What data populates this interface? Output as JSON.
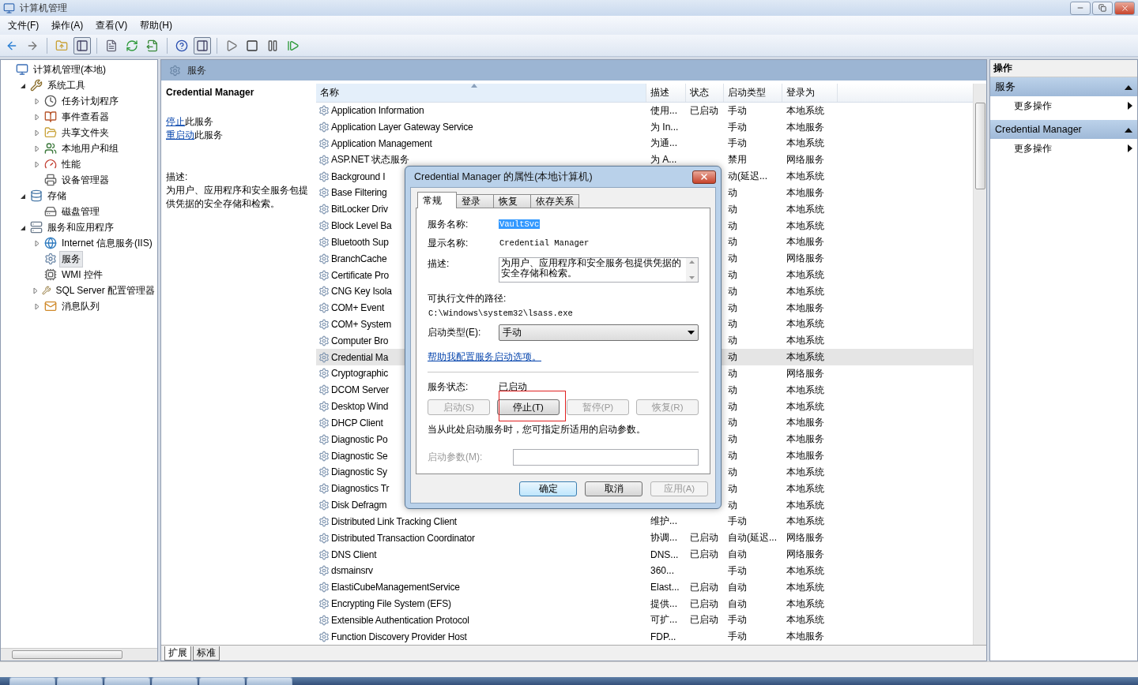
{
  "window": {
    "title": "计算机管理"
  },
  "menu": [
    "文件(F)",
    "操作(A)",
    "查看(V)",
    "帮助(H)"
  ],
  "tree": [
    {
      "label": "计算机管理(本地)",
      "kind": "computer",
      "selected": false,
      "children": [
        {
          "label": "系统工具",
          "kind": "tools",
          "expanded": true,
          "selected": false,
          "children": [
            {
              "label": "任务计划程序",
              "kind": "clock",
              "expanded": false,
              "selected": false
            },
            {
              "label": "事件查看器",
              "kind": "book",
              "expanded": false,
              "selected": false
            },
            {
              "label": "共享文件夹",
              "kind": "folder",
              "expanded": false,
              "selected": false
            },
            {
              "label": "本地用户和组",
              "kind": "users",
              "expanded": false,
              "selected": false
            },
            {
              "label": "性能",
              "kind": "gauge",
              "expanded": false,
              "selected": false
            },
            {
              "label": "设备管理器",
              "kind": "printer",
              "selected": false
            }
          ]
        },
        {
          "label": "存储",
          "kind": "database",
          "expanded": true,
          "selected": false,
          "children": [
            {
              "label": "磁盘管理",
              "kind": "disk",
              "selected": false
            }
          ]
        },
        {
          "label": "服务和应用程序",
          "kind": "server",
          "expanded": true,
          "selected": false,
          "children": [
            {
              "label": "Internet 信息服务(IIS)",
              "kind": "globe",
              "expanded": false,
              "selected": false
            },
            {
              "label": "服务",
              "kind": "gear",
              "selected": true
            },
            {
              "label": "WMI 控件",
              "kind": "cpu",
              "selected": false
            },
            {
              "label": "SQL Server 配置管理器",
              "kind": "tools",
              "expanded": false,
              "selected": false
            },
            {
              "label": "消息队列",
              "kind": "mail",
              "expanded": false,
              "selected": false
            }
          ]
        }
      ]
    }
  ],
  "panel": {
    "title": "服务",
    "service_name": "Credential Manager",
    "actions": [
      {
        "link": "停止",
        "text": "此服务"
      },
      {
        "link": "重启动",
        "text": "此服务"
      }
    ],
    "description_label": "描述:",
    "description": "为用户、应用程序和安全服务包提供凭据的安全存储和检索。"
  },
  "table": {
    "columns": [
      {
        "label": "名称",
        "sorted": true
      },
      {
        "label": "描述",
        "sorted": false
      },
      {
        "label": "状态",
        "sorted": false
      },
      {
        "label": "启动类型",
        "sorted": false
      },
      {
        "label": "登录为",
        "sorted": false
      }
    ],
    "rows": [
      {
        "name": "Application Information",
        "description": "使用...",
        "status": "已启动",
        "startup": "手动",
        "logon": "本地系统",
        "selected": false
      },
      {
        "name": "Application Layer Gateway Service",
        "description": "为 In...",
        "startup": "手动",
        "logon": "本地服务",
        "selected": false
      },
      {
        "name": "Application Management",
        "description": "为通...",
        "startup": "手动",
        "logon": "本地系统",
        "selected": false
      },
      {
        "name": "ASP.NET 状态服务",
        "description": "为 A...",
        "startup": "禁用",
        "logon": "网络服务",
        "selected": false
      },
      {
        "name": "Background I",
        "startup": "动(延迟...",
        "logon": "本地系统",
        "selected": false
      },
      {
        "name": "Base Filtering",
        "startup": "动",
        "logon": "本地服务",
        "selected": false
      },
      {
        "name": "BitLocker Driv",
        "startup": "动",
        "logon": "本地系统",
        "selected": false
      },
      {
        "name": "Block Level Ba",
        "startup": "动",
        "logon": "本地系统",
        "selected": false
      },
      {
        "name": "Bluetooth Sup",
        "startup": "动",
        "logon": "本地服务",
        "selected": false
      },
      {
        "name": "BranchCache",
        "startup": "动",
        "logon": "网络服务",
        "selected": false
      },
      {
        "name": "Certificate Pro",
        "startup": "动",
        "logon": "本地系统",
        "selected": false
      },
      {
        "name": "CNG Key Isola",
        "startup": "动",
        "logon": "本地系统",
        "selected": false
      },
      {
        "name": "COM+ Event",
        "startup": "动",
        "logon": "本地服务",
        "selected": false
      },
      {
        "name": "COM+ System",
        "startup": "动",
        "logon": "本地系统",
        "selected": false
      },
      {
        "name": "Computer Bro",
        "startup": "动",
        "logon": "本地系统",
        "selected": false
      },
      {
        "name": "Credential Ma",
        "startup": "动",
        "logon": "本地系统",
        "selected": true
      },
      {
        "name": "Cryptographic",
        "startup": "动",
        "logon": "网络服务",
        "selected": false
      },
      {
        "name": "DCOM Server",
        "startup": "动",
        "logon": "本地系统",
        "selected": false
      },
      {
        "name": "Desktop Wind",
        "startup": "动",
        "logon": "本地系统",
        "selected": false
      },
      {
        "name": "DHCP Client",
        "startup": "动",
        "logon": "本地服务",
        "selected": false
      },
      {
        "name": "Diagnostic Po",
        "startup": "动",
        "logon": "本地服务",
        "selected": false
      },
      {
        "name": "Diagnostic Se",
        "startup": "动",
        "logon": "本地服务",
        "selected": false
      },
      {
        "name": "Diagnostic Sy",
        "startup": "动",
        "logon": "本地系统",
        "selected": false
      },
      {
        "name": "Diagnostics Tr",
        "startup": "动",
        "logon": "本地系统",
        "selected": false
      },
      {
        "name": "Disk Defragm",
        "startup": "动",
        "logon": "本地系统",
        "selected": false
      },
      {
        "name": "Distributed Link Tracking Client",
        "description": "维护...",
        "startup": "手动",
        "logon": "本地系统",
        "selected": false
      },
      {
        "name": "Distributed Transaction Coordinator",
        "description": "协调...",
        "status": "已启动",
        "startup": "自动(延迟...",
        "logon": "网络服务",
        "selected": false
      },
      {
        "name": "DNS Client",
        "description": "DNS...",
        "status": "已启动",
        "startup": "自动",
        "logon": "网络服务",
        "selected": false
      },
      {
        "name": "dsmainsrv",
        "description": "360...",
        "startup": "手动",
        "logon": "本地系统",
        "selected": false
      },
      {
        "name": "ElastiCubeManagementService",
        "description": "Elast...",
        "status": "已启动",
        "startup": "自动",
        "logon": "本地系统",
        "selected": false
      },
      {
        "name": "Encrypting File System (EFS)",
        "description": "提供...",
        "status": "已启动",
        "startup": "自动",
        "logon": "本地系统",
        "selected": false
      },
      {
        "name": "Extensible Authentication Protocol",
        "description": "可扩...",
        "status": "已启动",
        "startup": "手动",
        "logon": "本地系统",
        "selected": false
      },
      {
        "name": "Function Discovery Provider Host",
        "description": "FDP...",
        "startup": "手动",
        "logon": "本地服务",
        "selected": false
      }
    ]
  },
  "bottom_tabs": [
    {
      "label": "扩展",
      "selected": true
    },
    {
      "label": "标准",
      "selected": false
    }
  ],
  "actions_pane": {
    "title": "操作",
    "groups": [
      {
        "title": "服务",
        "expanded": true,
        "items": [
          "更多操作"
        ]
      },
      {
        "title": "Credential Manager",
        "expanded": true,
        "items": [
          "更多操作"
        ]
      }
    ]
  },
  "dialog": {
    "title": "Credential Manager 的属性(本地计算机)",
    "tabs": [
      {
        "label": "常规",
        "selected": true
      },
      {
        "label": "登录",
        "selected": false
      },
      {
        "label": "恢复",
        "selected": false
      },
      {
        "label": "依存关系",
        "selected": false
      }
    ],
    "service_name": {
      "label": "服务名称:",
      "value": "VaultSvc",
      "selected": true
    },
    "display_name": {
      "label": "显示名称:",
      "value": "Credential Manager"
    },
    "description": {
      "label": "描述:",
      "value": "为用户、应用程序和安全服务包提供凭据的安全存储和检索。"
    },
    "path": {
      "label": "可执行文件的路径:",
      "value": "C:\\Windows\\system32\\lsass.exe"
    },
    "startup_type": {
      "label": "启动类型(E):",
      "value": "手动"
    },
    "help_link": "帮助我配置服务启动选项。",
    "status": {
      "label": "服务状态:",
      "value": "已启动"
    },
    "control_buttons": [
      {
        "label": "启动(S)",
        "disabled": true,
        "annotated": false
      },
      {
        "label": "停止(T)",
        "disabled": false,
        "annotated": true
      },
      {
        "label": "暂停(P)",
        "disabled": true,
        "annotated": false
      },
      {
        "label": "恢复(R)",
        "disabled": true,
        "annotated": false
      }
    ],
    "hint": "当从此处启动服务时，您可指定所适用的启动参数。",
    "params": {
      "label": "启动参数(M):",
      "disabled": true
    },
    "footer_buttons": [
      {
        "label": "确定",
        "default": true,
        "disabled": false
      },
      {
        "label": "取消",
        "default": false,
        "disabled": false
      },
      {
        "label": "应用(A)",
        "default": false,
        "disabled": true
      }
    ]
  }
}
